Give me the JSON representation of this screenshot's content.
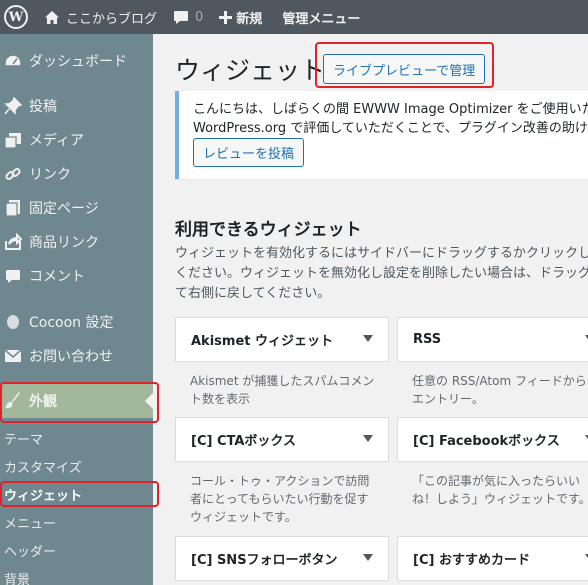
{
  "admin_bar": {
    "logo": "W",
    "site_name": "ここからブログ",
    "comment_count": "0",
    "new_label": "新規",
    "manage_label": "管理メニュー"
  },
  "sidebar": {
    "items": [
      {
        "label": "ダッシュボード",
        "icon": "dashboard-icon"
      },
      {
        "label": "投稿",
        "icon": "pin-icon"
      },
      {
        "label": "メディア",
        "icon": "media-icon"
      },
      {
        "label": "リンク",
        "icon": "link-icon"
      },
      {
        "label": "固定ページ",
        "icon": "page-icon"
      },
      {
        "label": "商品リンク",
        "icon": "share-icon"
      },
      {
        "label": "コメント",
        "icon": "comment-icon"
      },
      {
        "label": "Cocoon 設定",
        "icon": "cocoon-icon"
      },
      {
        "label": "お問い合わせ",
        "icon": "mail-icon"
      },
      {
        "label": "外観",
        "icon": "brush-icon"
      }
    ],
    "submenu": [
      "テーマ",
      "カスタマイズ",
      "ウィジェット",
      "メニュー",
      "ヘッダー",
      "背景"
    ]
  },
  "main": {
    "title": "ウィジェット",
    "live_preview_button": "ライブプレビューで管理",
    "notice": {
      "line1": "こんにちは、しばらくの間 EWWW Image Optimizer をご使用いただ",
      "line2": "WordPress.org で評価していただくことで、プラグイン改善の助けに",
      "button": "レビューを投稿"
    },
    "section_title": "利用できるウィジェット",
    "section_desc": [
      "ウィジェットを有効化するにはサイドバーにドラッグするかクリックし",
      "ください。ウィジェットを無効化し設定を削除したい場合は、ドラッグ",
      "て右側に戻してください。"
    ],
    "widgets": [
      {
        "name": "Akismet ウィジェット",
        "desc": [
          "Akismet が捕獲したスパムコメン",
          "ト数を表示"
        ]
      },
      {
        "name": "RSS",
        "desc": [
          "任意の RSS/Atom フィードからの",
          "エントリー。"
        ]
      },
      {
        "name": "[C] CTAボックス",
        "desc": [
          "コール・トゥ・アクションで訪問",
          "者にとってもらいたい行動を促す",
          "ウィジェットです。"
        ]
      },
      {
        "name": "[C] Facebookボックス",
        "desc": [
          "「この記事が気に入ったらいい",
          "ね！しよう」ウィジェットです。"
        ]
      },
      {
        "name": "[C] SNSフォローボタン",
        "desc": []
      },
      {
        "name": "[C] おすすめカード",
        "desc": []
      }
    ]
  },
  "colors": {
    "admin_bar": "#4f585f",
    "sidebar": "#6f878f",
    "current_menu": "#a3b89a",
    "highlight": "#e0222a",
    "accent": "#2271b1"
  }
}
